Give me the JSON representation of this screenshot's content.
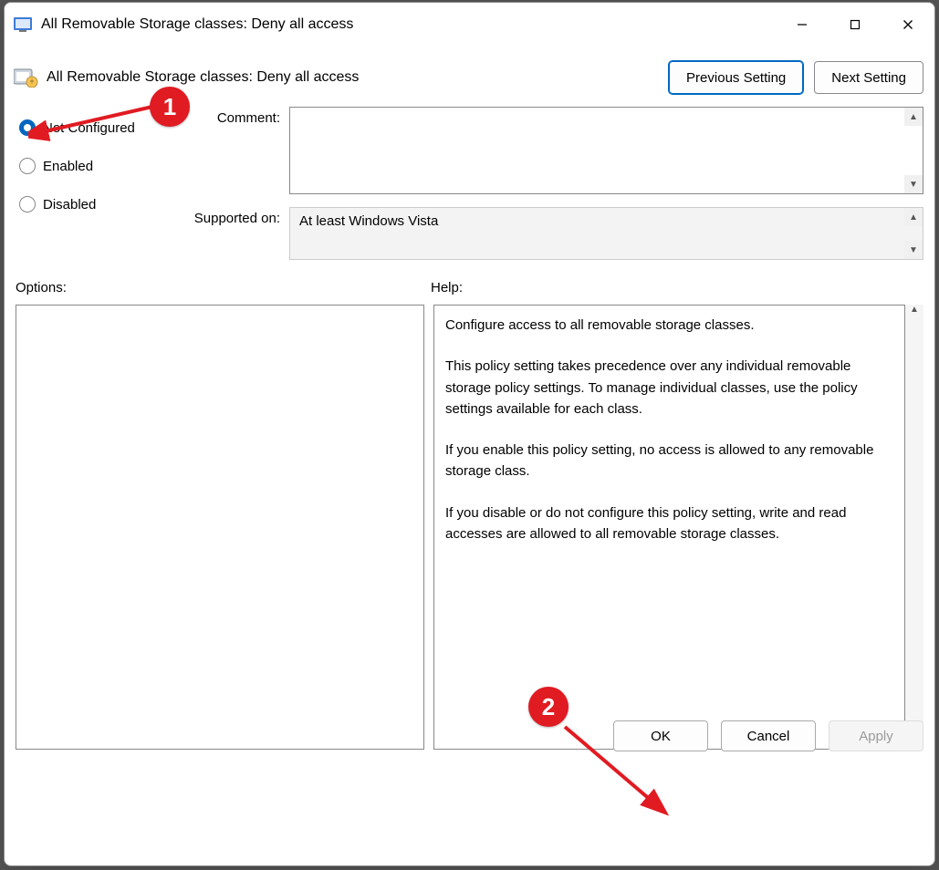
{
  "window": {
    "title": "All Removable Storage classes: Deny all access"
  },
  "header": {
    "title": "All Removable Storage classes: Deny all access"
  },
  "nav": {
    "previous": "Previous Setting",
    "next": "Next Setting"
  },
  "state": {
    "comment_label": "Comment:",
    "supported_label": "Supported on:",
    "supported_value": "At least Windows Vista",
    "radios": {
      "not_configured": "Not Configured",
      "enabled": "Enabled",
      "disabled": "Disabled"
    },
    "comment_value": ""
  },
  "panes": {
    "options_label": "Options:",
    "help_label": "Help:"
  },
  "help": {
    "p1": "Configure access to all removable storage classes.",
    "p2": "This policy setting takes precedence over any individual removable storage policy settings. To manage individual classes, use the policy settings available for each class.",
    "p3": "If you enable this policy setting, no access is allowed to any removable storage class.",
    "p4": "If you disable or do not configure this policy setting, write and read accesses are allowed to all removable storage classes."
  },
  "buttons": {
    "ok": "OK",
    "cancel": "Cancel",
    "apply": "Apply"
  },
  "annotations": {
    "b1": "1",
    "b2": "2"
  }
}
